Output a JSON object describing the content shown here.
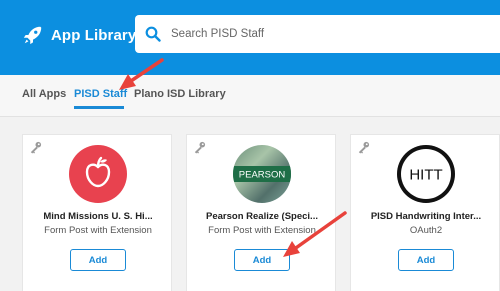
{
  "header": {
    "app_title": "App Library",
    "search": {
      "placeholder": "Search PISD Staff",
      "value": ""
    }
  },
  "tabs": [
    {
      "label": "All Apps",
      "active": false
    },
    {
      "label": "PISD Staff",
      "active": true
    },
    {
      "label": "Plano ISD Library",
      "active": false
    }
  ],
  "apps": [
    {
      "title": "Mind Missions U. S. Hi...",
      "subtitle": "Form Post with Extension",
      "add_label": "Add",
      "logo": "apple-icon",
      "logo_color": "#e8424f"
    },
    {
      "title": "Pearson Realize (Speci...",
      "subtitle": "Form Post with Extension",
      "add_label": "Add",
      "logo": "pearson-logo",
      "logo_text": "PEARSON",
      "logo_color": "#1f6e47"
    },
    {
      "title": "PISD Handwriting Inter...",
      "subtitle": "OAuth2",
      "add_label": "Add",
      "logo": "hitt-logo",
      "logo_text": "HITT",
      "logo_color": "#111111"
    }
  ],
  "colors": {
    "header": "#0c8fe0",
    "accent": "#1a8ad6",
    "annotation_arrow": "#e8423b"
  }
}
